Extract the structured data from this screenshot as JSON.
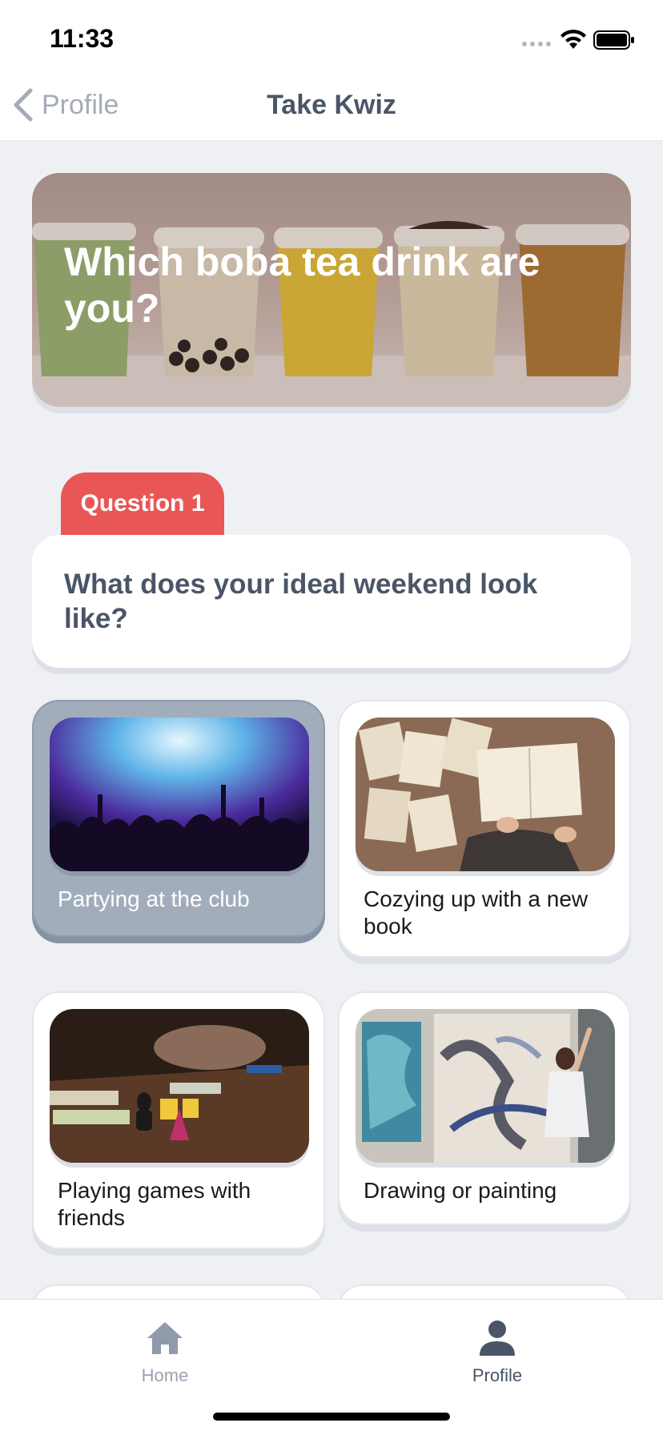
{
  "status": {
    "time": "11:33"
  },
  "nav": {
    "back_label": "Profile",
    "title": "Take Kwiz"
  },
  "quiz": {
    "title": "Which boba tea drink are you?"
  },
  "question": {
    "tab_label": "Question 1",
    "text": "What does your ideal weekend look like?"
  },
  "options": [
    {
      "label": "Partying at the club",
      "selected": true
    },
    {
      "label": "Cozying up with a new book",
      "selected": false
    },
    {
      "label": "Playing games with friends",
      "selected": false
    },
    {
      "label": "Drawing or painting",
      "selected": false
    }
  ],
  "tabbar": {
    "items": [
      {
        "label": "Home",
        "icon": "home-icon",
        "active": false
      },
      {
        "label": "Profile",
        "icon": "person-icon",
        "active": true
      }
    ]
  },
  "colors": {
    "accent_red": "#e85656",
    "text_slate": "#4a5568",
    "selected_card": "#a2adbc",
    "background": "#eef0f4"
  }
}
